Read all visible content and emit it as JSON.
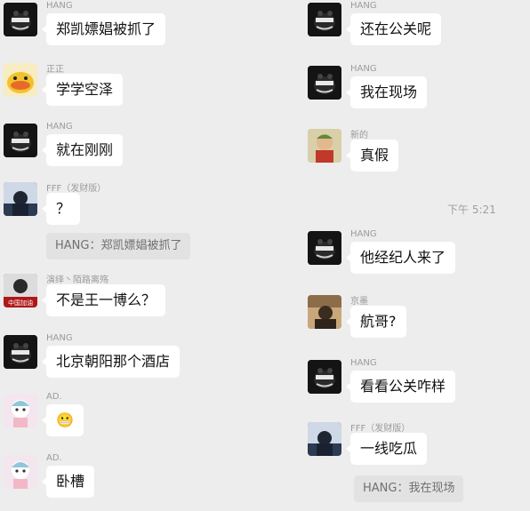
{
  "left_messages": [
    {
      "sender": "HANG",
      "text": "郑凯嫖娼被抓了",
      "avatar": "hang-avatar"
    },
    {
      "sender": "正正",
      "text": "学学空泽",
      "avatar": "duck-avatar"
    },
    {
      "sender": "HANG",
      "text": "就在刚刚",
      "avatar": "hang-avatar"
    },
    {
      "sender": "FFF（发财版）",
      "text": "？",
      "avatar": "fff-avatar"
    },
    {
      "sender": "演绎丶陌路离殇",
      "text": "不是王一博么？",
      "avatar": "wutan-avatar",
      "avatar_text": "中国加油"
    },
    {
      "sender": "HANG",
      "text": "北京朝阳那个酒店",
      "avatar": "hang-avatar"
    },
    {
      "sender": "AD.",
      "text": "😬",
      "avatar": "ad-avatar"
    },
    {
      "sender": "AD.",
      "text": "卧槽",
      "avatar": "ad-avatar"
    }
  ],
  "left_quote": "HANG：郑凯嫖娼被抓了",
  "right_messages": [
    {
      "sender": "HANG",
      "text": "还在公关呢",
      "avatar": "hang-avatar"
    },
    {
      "sender": "HANG",
      "text": "我在现场",
      "avatar": "hang-avatar"
    },
    {
      "sender": "新的",
      "text": "真假",
      "avatar": "xinde-avatar"
    },
    {
      "sender": "HANG",
      "text": "他经纪人来了",
      "avatar": "hang-avatar"
    },
    {
      "sender": "京墨",
      "text": "航哥?",
      "avatar": "jingmo-avatar"
    },
    {
      "sender": "HANG",
      "text": "看看公关咋样",
      "avatar": "hang-avatar"
    },
    {
      "sender": "FFF（发财版）",
      "text": "一线吃瓜",
      "avatar": "fff-avatar"
    }
  ],
  "right_quote": "HANG：我在现场",
  "timestamp": "下午 5:21",
  "colors": {
    "background": "#ededed",
    "bubble": "#ffffff",
    "quote": "#e2e2e2"
  }
}
